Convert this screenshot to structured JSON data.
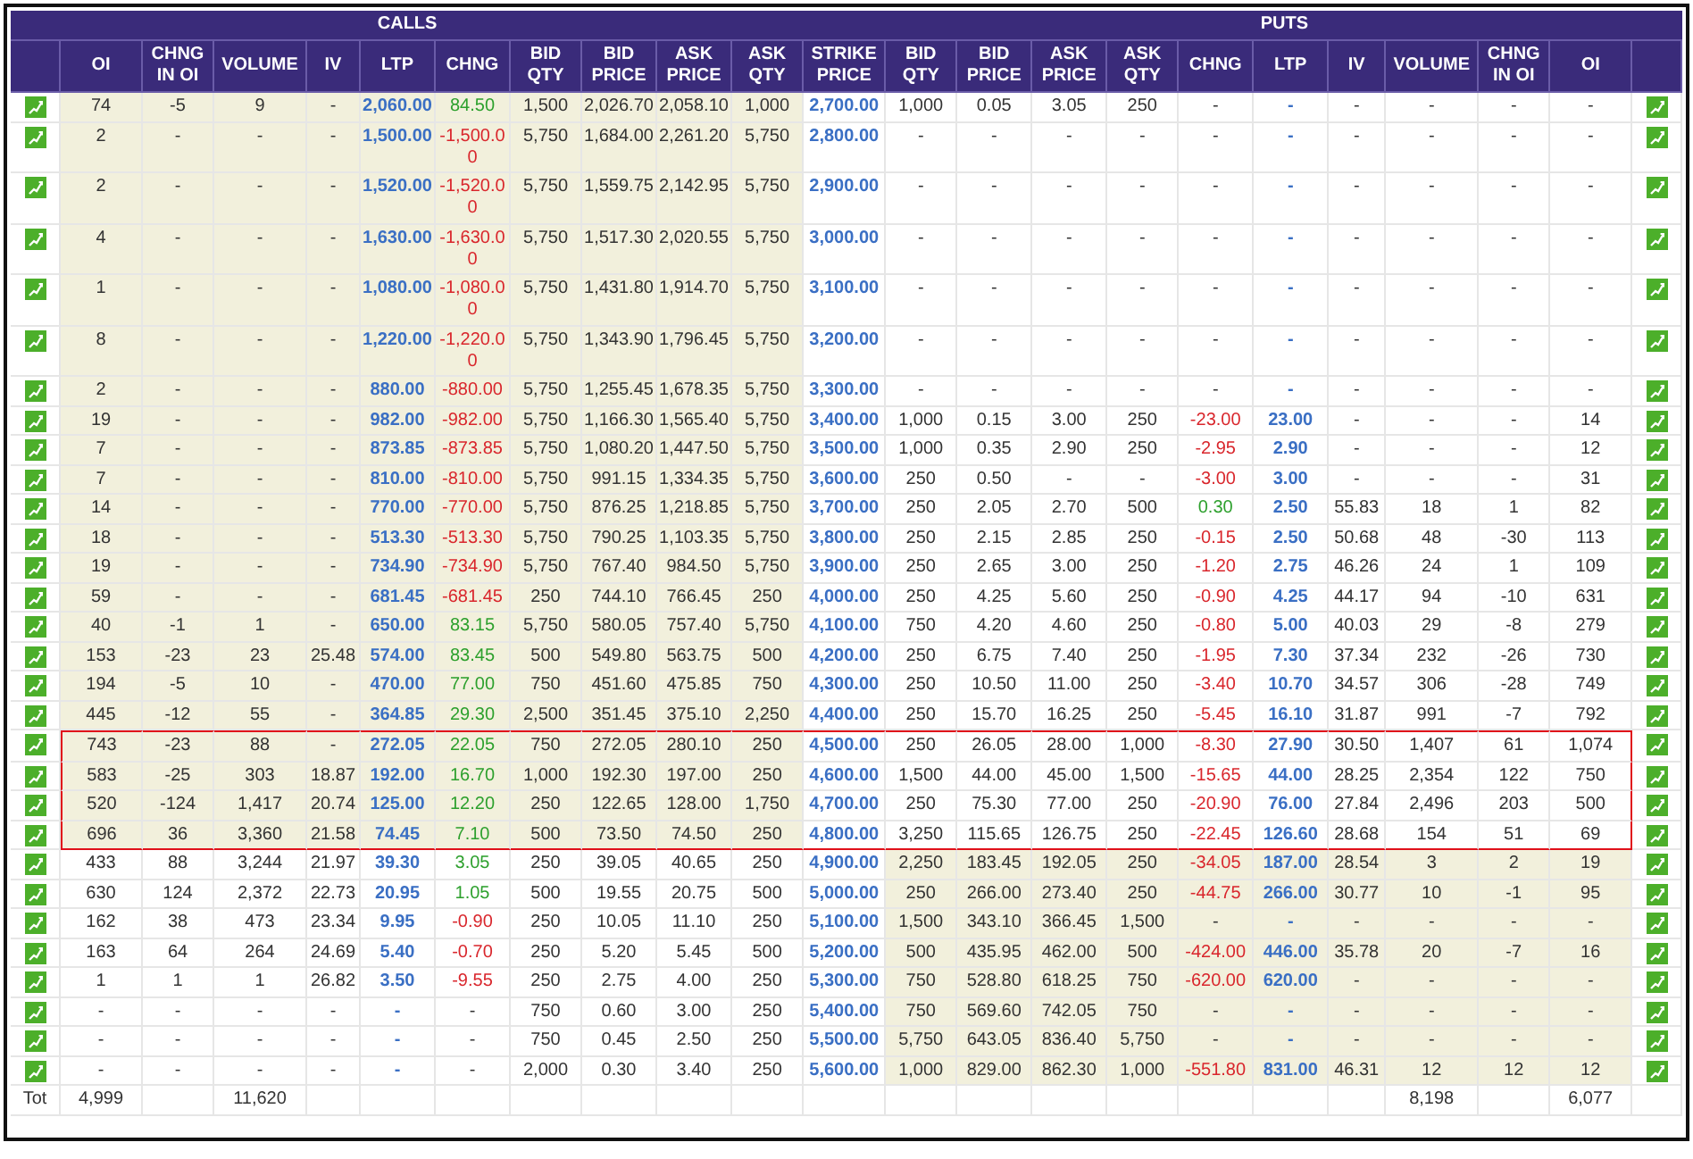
{
  "section_headers": {
    "calls": "CALLS",
    "puts": "PUTS"
  },
  "calls_columns": [
    "OI",
    "CHNG IN OI",
    "VOLUME",
    "IV",
    "LTP",
    "CHNG",
    "BID QTY",
    "BID PRICE",
    "ASK PRICE",
    "ASK QTY"
  ],
  "strike_column": "STRIKE PRICE",
  "puts_columns": [
    "BID QTY",
    "BID PRICE",
    "ASK PRICE",
    "ASK QTY",
    "CHNG",
    "LTP",
    "IV",
    "VOLUME",
    "CHNG IN OI",
    "OI"
  ],
  "rows": [
    {
      "strike": "2,700.00",
      "calls": [
        "74",
        "-5",
        "9",
        "-",
        "2,060.00",
        "84.50",
        "1,500",
        "2,026.70",
        "2,058.10",
        "1,000"
      ],
      "puts": [
        "1,000",
        "0.05",
        "3.05",
        "250",
        "-",
        "-",
        "-",
        "-",
        "-",
        "-"
      ],
      "calls_itm": true,
      "puts_itm": false,
      "highlighted": false
    },
    {
      "strike": "2,800.00",
      "calls": [
        "2",
        "-",
        "-",
        "-",
        "1,500.00",
        "-1,500.00",
        "5,750",
        "1,684.00",
        "2,261.20",
        "5,750"
      ],
      "puts": [
        "-",
        "-",
        "-",
        "-",
        "-",
        "-",
        "-",
        "-",
        "-",
        "-"
      ],
      "calls_itm": true,
      "puts_itm": false,
      "highlighted": false
    },
    {
      "strike": "2,900.00",
      "calls": [
        "2",
        "-",
        "-",
        "-",
        "1,520.00",
        "-1,520.00",
        "5,750",
        "1,559.75",
        "2,142.95",
        "5,750"
      ],
      "puts": [
        "-",
        "-",
        "-",
        "-",
        "-",
        "-",
        "-",
        "-",
        "-",
        "-"
      ],
      "calls_itm": true,
      "puts_itm": false,
      "highlighted": false
    },
    {
      "strike": "3,000.00",
      "calls": [
        "4",
        "-",
        "-",
        "-",
        "1,630.00",
        "-1,630.00",
        "5,750",
        "1,517.30",
        "2,020.55",
        "5,750"
      ],
      "puts": [
        "-",
        "-",
        "-",
        "-",
        "-",
        "-",
        "-",
        "-",
        "-",
        "-"
      ],
      "calls_itm": true,
      "puts_itm": false,
      "highlighted": false
    },
    {
      "strike": "3,100.00",
      "calls": [
        "1",
        "-",
        "-",
        "-",
        "1,080.00",
        "-1,080.00",
        "5,750",
        "1,431.80",
        "1,914.70",
        "5,750"
      ],
      "puts": [
        "-",
        "-",
        "-",
        "-",
        "-",
        "-",
        "-",
        "-",
        "-",
        "-"
      ],
      "calls_itm": true,
      "puts_itm": false,
      "highlighted": false
    },
    {
      "strike": "3,200.00",
      "calls": [
        "8",
        "-",
        "-",
        "-",
        "1,220.00",
        "-1,220.00",
        "5,750",
        "1,343.90",
        "1,796.45",
        "5,750"
      ],
      "puts": [
        "-",
        "-",
        "-",
        "-",
        "-",
        "-",
        "-",
        "-",
        "-",
        "-"
      ],
      "calls_itm": true,
      "puts_itm": false,
      "highlighted": false
    },
    {
      "strike": "3,300.00",
      "calls": [
        "2",
        "-",
        "-",
        "-",
        "880.00",
        "-880.00",
        "5,750",
        "1,255.45",
        "1,678.35",
        "5,750"
      ],
      "puts": [
        "-",
        "-",
        "-",
        "-",
        "-",
        "-",
        "-",
        "-",
        "-",
        "-"
      ],
      "calls_itm": true,
      "puts_itm": false,
      "highlighted": false
    },
    {
      "strike": "3,400.00",
      "calls": [
        "19",
        "-",
        "-",
        "-",
        "982.00",
        "-982.00",
        "5,750",
        "1,166.30",
        "1,565.40",
        "5,750"
      ],
      "puts": [
        "1,000",
        "0.15",
        "3.00",
        "250",
        "-23.00",
        "23.00",
        "-",
        "-",
        "-",
        "14"
      ],
      "calls_itm": true,
      "puts_itm": false,
      "highlighted": false
    },
    {
      "strike": "3,500.00",
      "calls": [
        "7",
        "-",
        "-",
        "-",
        "873.85",
        "-873.85",
        "5,750",
        "1,080.20",
        "1,447.50",
        "5,750"
      ],
      "puts": [
        "1,000",
        "0.35",
        "2.90",
        "250",
        "-2.95",
        "2.90",
        "-",
        "-",
        "-",
        "12"
      ],
      "calls_itm": true,
      "puts_itm": false,
      "highlighted": false
    },
    {
      "strike": "3,600.00",
      "calls": [
        "7",
        "-",
        "-",
        "-",
        "810.00",
        "-810.00",
        "5,750",
        "991.15",
        "1,334.35",
        "5,750"
      ],
      "puts": [
        "250",
        "0.50",
        "-",
        "-",
        "-3.00",
        "3.00",
        "-",
        "-",
        "-",
        "31"
      ],
      "calls_itm": true,
      "puts_itm": false,
      "highlighted": false
    },
    {
      "strike": "3,700.00",
      "calls": [
        "14",
        "-",
        "-",
        "-",
        "770.00",
        "-770.00",
        "5,750",
        "876.25",
        "1,218.85",
        "5,750"
      ],
      "puts": [
        "250",
        "2.05",
        "2.70",
        "500",
        "0.30",
        "2.50",
        "55.83",
        "18",
        "1",
        "82"
      ],
      "calls_itm": true,
      "puts_itm": false,
      "highlighted": false
    },
    {
      "strike": "3,800.00",
      "calls": [
        "18",
        "-",
        "-",
        "-",
        "513.30",
        "-513.30",
        "5,750",
        "790.25",
        "1,103.35",
        "5,750"
      ],
      "puts": [
        "250",
        "2.15",
        "2.85",
        "250",
        "-0.15",
        "2.50",
        "50.68",
        "48",
        "-30",
        "113"
      ],
      "calls_itm": true,
      "puts_itm": false,
      "highlighted": false
    },
    {
      "strike": "3,900.00",
      "calls": [
        "19",
        "-",
        "-",
        "-",
        "734.90",
        "-734.90",
        "5,750",
        "767.40",
        "984.50",
        "5,750"
      ],
      "puts": [
        "250",
        "2.65",
        "3.00",
        "250",
        "-1.20",
        "2.75",
        "46.26",
        "24",
        "1",
        "109"
      ],
      "calls_itm": true,
      "puts_itm": false,
      "highlighted": false
    },
    {
      "strike": "4,000.00",
      "calls": [
        "59",
        "-",
        "-",
        "-",
        "681.45",
        "-681.45",
        "250",
        "744.10",
        "766.45",
        "250"
      ],
      "puts": [
        "250",
        "4.25",
        "5.60",
        "250",
        "-0.90",
        "4.25",
        "44.17",
        "94",
        "-10",
        "631"
      ],
      "calls_itm": true,
      "puts_itm": false,
      "highlighted": false
    },
    {
      "strike": "4,100.00",
      "calls": [
        "40",
        "-1",
        "1",
        "-",
        "650.00",
        "83.15",
        "5,750",
        "580.05",
        "757.40",
        "5,750"
      ],
      "puts": [
        "750",
        "4.20",
        "4.60",
        "250",
        "-0.80",
        "5.00",
        "40.03",
        "29",
        "-8",
        "279"
      ],
      "calls_itm": true,
      "puts_itm": false,
      "highlighted": false
    },
    {
      "strike": "4,200.00",
      "calls": [
        "153",
        "-23",
        "23",
        "25.48",
        "574.00",
        "83.45",
        "500",
        "549.80",
        "563.75",
        "500"
      ],
      "puts": [
        "250",
        "6.75",
        "7.40",
        "250",
        "-1.95",
        "7.30",
        "37.34",
        "232",
        "-26",
        "730"
      ],
      "calls_itm": true,
      "puts_itm": false,
      "highlighted": false
    },
    {
      "strike": "4,300.00",
      "calls": [
        "194",
        "-5",
        "10",
        "-",
        "470.00",
        "77.00",
        "750",
        "451.60",
        "475.85",
        "750"
      ],
      "puts": [
        "250",
        "10.50",
        "11.00",
        "250",
        "-3.40",
        "10.70",
        "34.57",
        "306",
        "-28",
        "749"
      ],
      "calls_itm": true,
      "puts_itm": false,
      "highlighted": false
    },
    {
      "strike": "4,400.00",
      "calls": [
        "445",
        "-12",
        "55",
        "-",
        "364.85",
        "29.30",
        "2,500",
        "351.45",
        "375.10",
        "2,250"
      ],
      "puts": [
        "250",
        "15.70",
        "16.25",
        "250",
        "-5.45",
        "16.10",
        "31.87",
        "991",
        "-7",
        "792"
      ],
      "calls_itm": true,
      "puts_itm": false,
      "highlighted": false
    },
    {
      "strike": "4,500.00",
      "calls": [
        "743",
        "-23",
        "88",
        "-",
        "272.05",
        "22.05",
        "750",
        "272.05",
        "280.10",
        "250"
      ],
      "puts": [
        "250",
        "26.05",
        "28.00",
        "1,000",
        "-8.30",
        "27.90",
        "30.50",
        "1,407",
        "61",
        "1,074"
      ],
      "calls_itm": true,
      "puts_itm": false,
      "highlighted": true
    },
    {
      "strike": "4,600.00",
      "calls": [
        "583",
        "-25",
        "303",
        "18.87",
        "192.00",
        "16.70",
        "1,000",
        "192.30",
        "197.00",
        "250"
      ],
      "puts": [
        "1,500",
        "44.00",
        "45.00",
        "1,500",
        "-15.65",
        "44.00",
        "28.25",
        "2,354",
        "122",
        "750"
      ],
      "calls_itm": true,
      "puts_itm": false,
      "highlighted": true
    },
    {
      "strike": "4,700.00",
      "calls": [
        "520",
        "-124",
        "1,417",
        "20.74",
        "125.00",
        "12.20",
        "250",
        "122.65",
        "128.00",
        "1,750"
      ],
      "puts": [
        "250",
        "75.30",
        "77.00",
        "250",
        "-20.90",
        "76.00",
        "27.84",
        "2,496",
        "203",
        "500"
      ],
      "calls_itm": true,
      "puts_itm": false,
      "highlighted": true
    },
    {
      "strike": "4,800.00",
      "calls": [
        "696",
        "36",
        "3,360",
        "21.58",
        "74.45",
        "7.10",
        "500",
        "73.50",
        "74.50",
        "250"
      ],
      "puts": [
        "3,250",
        "115.65",
        "126.75",
        "250",
        "-22.45",
        "126.60",
        "28.68",
        "154",
        "51",
        "69"
      ],
      "calls_itm": true,
      "puts_itm": false,
      "highlighted": true
    },
    {
      "strike": "4,900.00",
      "calls": [
        "433",
        "88",
        "3,244",
        "21.97",
        "39.30",
        "3.05",
        "250",
        "39.05",
        "40.65",
        "250"
      ],
      "puts": [
        "2,250",
        "183.45",
        "192.05",
        "250",
        "-34.05",
        "187.00",
        "28.54",
        "3",
        "2",
        "19"
      ],
      "calls_itm": false,
      "puts_itm": true,
      "highlighted": false
    },
    {
      "strike": "5,000.00",
      "calls": [
        "630",
        "124",
        "2,372",
        "22.73",
        "20.95",
        "1.05",
        "500",
        "19.55",
        "20.75",
        "500"
      ],
      "puts": [
        "250",
        "266.00",
        "273.40",
        "250",
        "-44.75",
        "266.00",
        "30.77",
        "10",
        "-1",
        "95"
      ],
      "calls_itm": false,
      "puts_itm": true,
      "highlighted": false
    },
    {
      "strike": "5,100.00",
      "calls": [
        "162",
        "38",
        "473",
        "23.34",
        "9.95",
        "-0.90",
        "250",
        "10.05",
        "11.10",
        "250"
      ],
      "puts": [
        "1,500",
        "343.10",
        "366.45",
        "1,500",
        "-",
        "-",
        "-",
        "-",
        "-",
        "-"
      ],
      "calls_itm": false,
      "puts_itm": true,
      "highlighted": false
    },
    {
      "strike": "5,200.00",
      "calls": [
        "163",
        "64",
        "264",
        "24.69",
        "5.40",
        "-0.70",
        "250",
        "5.20",
        "5.45",
        "500"
      ],
      "puts": [
        "500",
        "435.95",
        "462.00",
        "500",
        "-424.00",
        "446.00",
        "35.78",
        "20",
        "-7",
        "16"
      ],
      "calls_itm": false,
      "puts_itm": true,
      "highlighted": false
    },
    {
      "strike": "5,300.00",
      "calls": [
        "1",
        "1",
        "1",
        "26.82",
        "3.50",
        "-9.55",
        "250",
        "2.75",
        "4.00",
        "250"
      ],
      "puts": [
        "750",
        "528.80",
        "618.25",
        "750",
        "-620.00",
        "620.00",
        "-",
        "-",
        "-",
        "-"
      ],
      "calls_itm": false,
      "puts_itm": true,
      "highlighted": false
    },
    {
      "strike": "5,400.00",
      "calls": [
        "-",
        "-",
        "-",
        "-",
        "-",
        "-",
        "750",
        "0.60",
        "3.00",
        "250"
      ],
      "puts": [
        "750",
        "569.60",
        "742.05",
        "750",
        "-",
        "-",
        "-",
        "-",
        "-",
        "-"
      ],
      "calls_itm": false,
      "puts_itm": true,
      "highlighted": false
    },
    {
      "strike": "5,500.00",
      "calls": [
        "-",
        "-",
        "-",
        "-",
        "-",
        "-",
        "750",
        "0.45",
        "2.50",
        "250"
      ],
      "puts": [
        "5,750",
        "643.05",
        "836.40",
        "5,750",
        "-",
        "-",
        "-",
        "-",
        "-",
        "-"
      ],
      "calls_itm": false,
      "puts_itm": true,
      "highlighted": false
    },
    {
      "strike": "5,600.00",
      "calls": [
        "-",
        "-",
        "-",
        "-",
        "-",
        "-",
        "2,000",
        "0.30",
        "3.40",
        "250"
      ],
      "puts": [
        "1,000",
        "829.00",
        "862.30",
        "1,000",
        "-551.80",
        "831.00",
        "46.31",
        "12",
        "12",
        "12"
      ],
      "calls_itm": false,
      "puts_itm": true,
      "highlighted": false
    }
  ],
  "totals": {
    "label": "Tot",
    "calls_oi": "4,999",
    "calls_volume": "11,620",
    "puts_volume": "8,198",
    "puts_oi": "6,077"
  }
}
